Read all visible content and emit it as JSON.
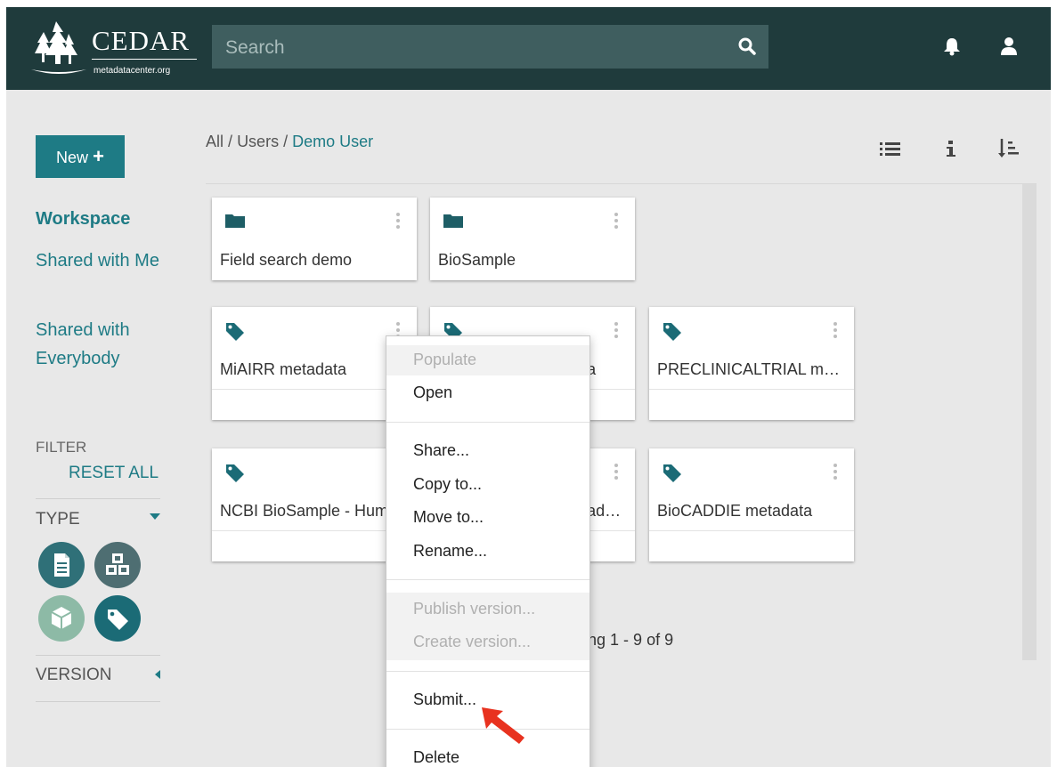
{
  "header": {
    "brand": "CEDAR",
    "brand_sub": "metadatacenter.org",
    "search_placeholder": "Search"
  },
  "sidebar": {
    "new_button": "New",
    "nav": [
      "Workspace",
      "Shared with Me",
      "Shared with Everybody"
    ],
    "filter_title": "FILTER",
    "reset_all": "RESET ALL",
    "type_label": "TYPE",
    "version_label": "VERSION"
  },
  "breadcrumb": {
    "all": "All",
    "sep": "/",
    "users": "Users",
    "current": "Demo User"
  },
  "cards": [
    {
      "kind": "folder",
      "title": "Field search demo"
    },
    {
      "kind": "folder",
      "title": "BioSample"
    },
    {
      "kind": "template",
      "title": "MiAIRR metadata"
    },
    {
      "kind": "template",
      "title": "Clinical Trial metadata"
    },
    {
      "kind": "template",
      "title": "PRECLINICALTRIAL metadata"
    },
    {
      "kind": "template",
      "title": "NCBI BioSample - Human"
    },
    {
      "kind": "template",
      "title": "GEO BioSample metadata"
    },
    {
      "kind": "template",
      "title": "BioCADDIE metadata"
    }
  ],
  "showing": "Showing 1 - 9 of 9",
  "context_menu": {
    "populate": "Populate",
    "open": "Open",
    "share": "Share...",
    "copy": "Copy to...",
    "move": "Move to...",
    "rename": "Rename...",
    "publish": "Publish version...",
    "create_version": "Create version...",
    "submit": "Submit...",
    "delete": "Delete"
  },
  "colors": {
    "header": "#1f3b3c",
    "accent": "#1e7b85",
    "background": "#e8e8e8"
  },
  "icons": [
    "search-icon",
    "bell-icon",
    "user-icon",
    "list-view-icon",
    "info-icon",
    "sort-icon",
    "folder-icon",
    "tag-icon",
    "kebab-icon"
  ]
}
